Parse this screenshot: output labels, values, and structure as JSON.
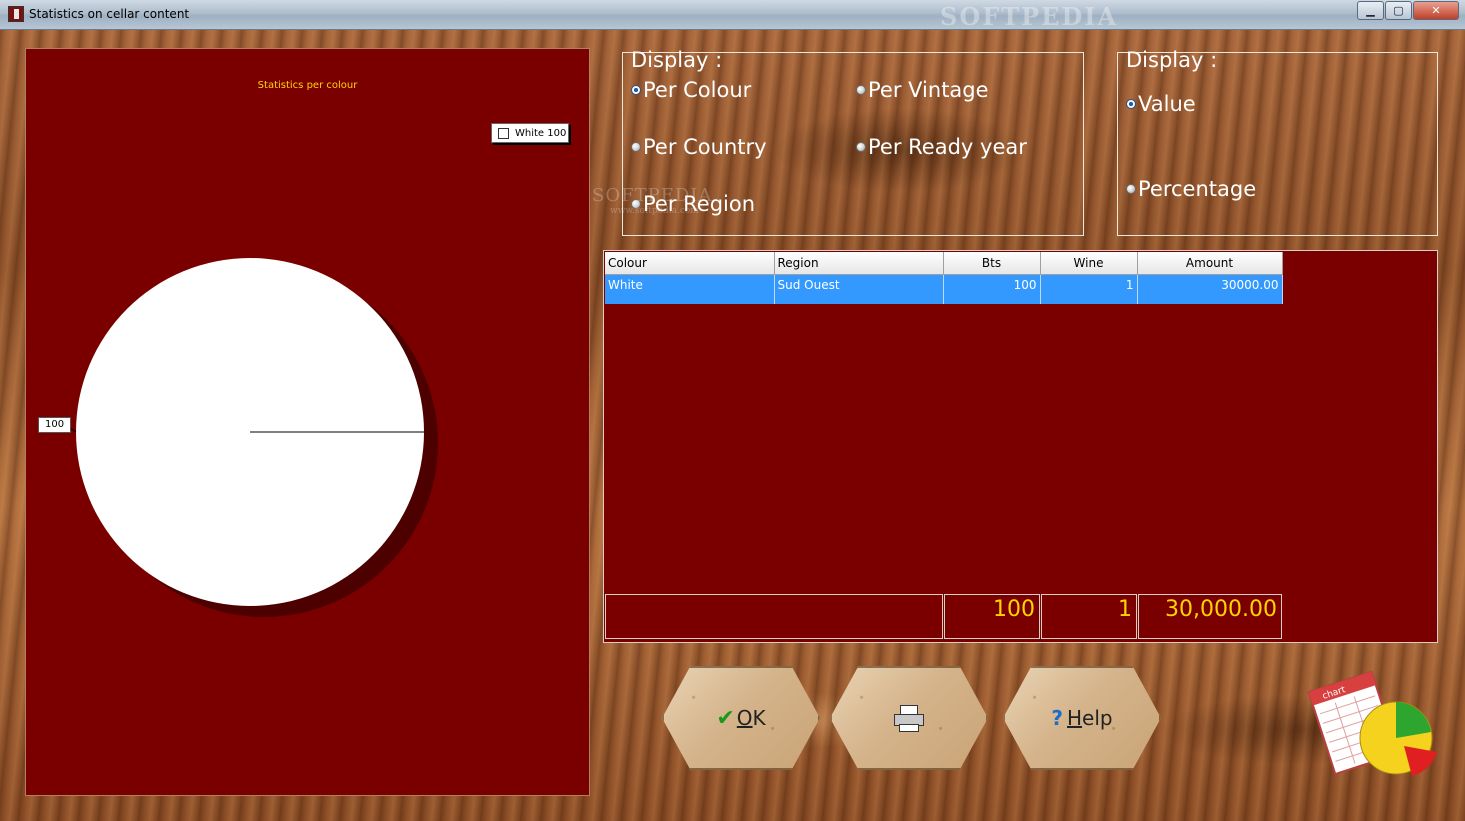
{
  "window": {
    "title": "Statistics on cellar content",
    "watermark": "SOFTPEDIA"
  },
  "chart": {
    "title": "Statistics per colour",
    "legend_label": "White 100",
    "slice_label": "100",
    "colors": {
      "background": "#7a0000",
      "slice": "#ffffff",
      "title": "#ffd400"
    }
  },
  "chart_data": {
    "type": "pie",
    "title": "Statistics per colour",
    "categories": [
      "White"
    ],
    "values": [
      100
    ]
  },
  "display_group": {
    "title": "Display :",
    "options": [
      {
        "label": "Per Colour",
        "selected": true
      },
      {
        "label": "Per Vintage",
        "selected": false
      },
      {
        "label": "Per Country",
        "selected": false
      },
      {
        "label": "Per Ready year",
        "selected": false
      },
      {
        "label": "Per Region",
        "selected": false
      }
    ]
  },
  "value_group": {
    "title": "Display :",
    "options": [
      {
        "label": "Value",
        "selected": true
      },
      {
        "label": "Percentage",
        "selected": false
      }
    ]
  },
  "center_watermark": {
    "main": "SOFTPEDIA",
    "sub": "www.softpedia.com"
  },
  "table": {
    "headers": [
      "Colour",
      "Region",
      "Bts",
      "Wine",
      "Amount"
    ],
    "rows": [
      [
        "White",
        "Sud Ouest",
        "100",
        "1",
        "30000.00"
      ]
    ],
    "totals": {
      "bts": "100",
      "wine": "1",
      "amount": "30,000.00"
    }
  },
  "buttons": {
    "ok": {
      "label_underlined": "O",
      "label_rest": "K",
      "icon": "check-icon"
    },
    "print": {
      "icon": "printer-icon"
    },
    "help": {
      "label_underlined": "H",
      "label_rest": "elp",
      "icon": "question-icon"
    }
  },
  "deco_icon": {
    "badge_text": "chart"
  }
}
